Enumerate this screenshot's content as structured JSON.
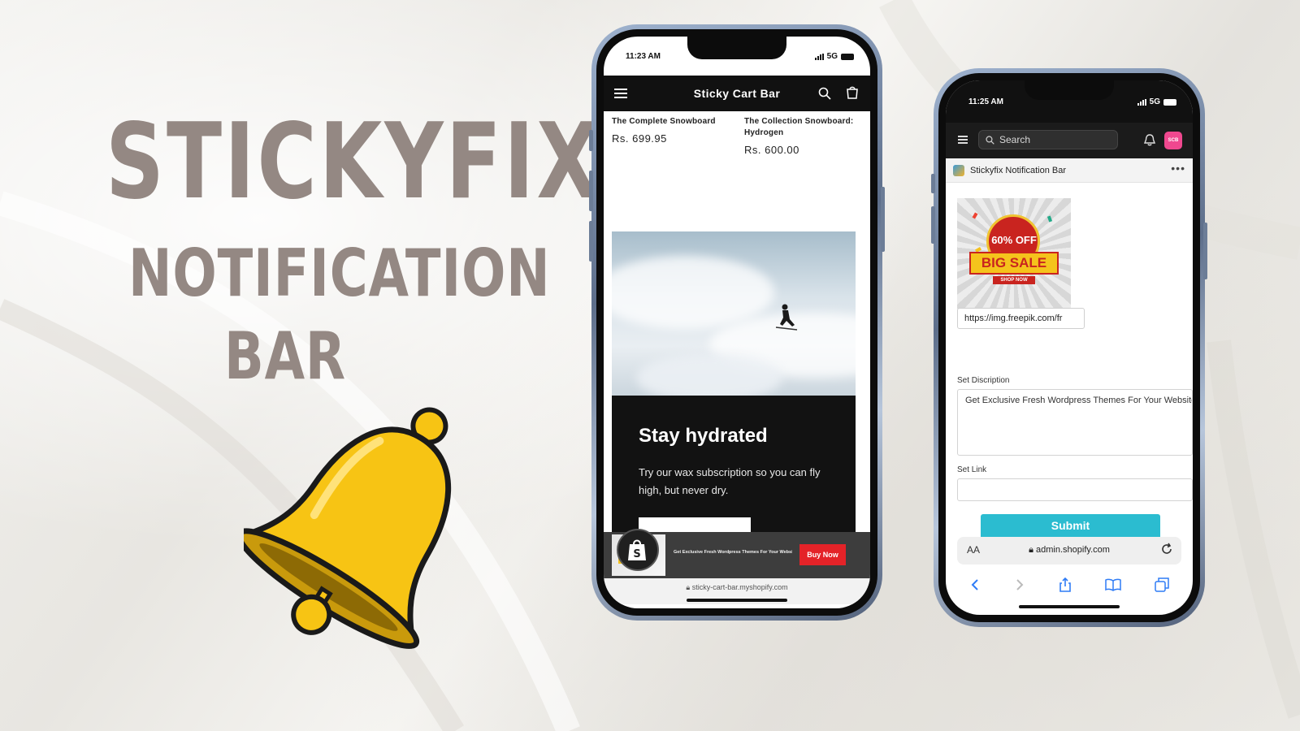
{
  "promo": {
    "title_line1": "STICKYFIX",
    "title_line2": "NOTIFICATION",
    "title_line3": "BAR"
  },
  "storefront": {
    "status_time": "11:23 AM",
    "network": "5G",
    "store_name": "Sticky Cart Bar",
    "products": [
      {
        "name": "The Complete Snowboard",
        "price": "Rs. 699.95"
      },
      {
        "name": "The Collection Snowboard: Hydrogen",
        "price": "Rs. 600.00"
      }
    ],
    "banner": {
      "heading": "Stay hydrated",
      "body": "Try our wax subscription so you can fly high, but never dry."
    },
    "sticky_bar": {
      "message": "Get Exclusive Fresh Wordpress Themes For Your Website",
      "button_label": "Buy Now",
      "button_color": "#e42328"
    },
    "url": "sticky-cart-bar.myshopify.com"
  },
  "admin": {
    "status_time": "11:25 AM",
    "network": "5G",
    "search_placeholder": "Search",
    "avatar_initials": "SCB",
    "app_name": "Stickyfix Notification Bar",
    "more_label": "•••",
    "sale_image": {
      "discount": "60% OFF",
      "headline": "BIG SALE",
      "cta": "SHOP NOW"
    },
    "image_url": "https://img.freepik.com/fr",
    "description_label": "Set Discription",
    "description_value": "Get Exclusive Fresh Wordpress Themes For Your Website",
    "link_label": "Set Link",
    "link_value": "",
    "submit_label": "Submit",
    "submit_color": "#2bbcd0",
    "text_size_label": "AA",
    "url": "admin.shopify.com"
  }
}
